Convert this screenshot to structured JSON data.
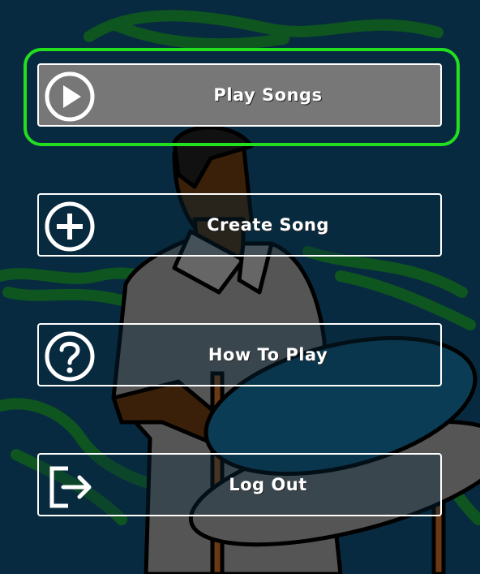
{
  "colors": {
    "background": "#082a40",
    "focus_ring": "#22e01e",
    "selected_fill": "#777777",
    "border": "#ffffff"
  },
  "menu": {
    "selected_index": 0,
    "items": [
      {
        "label": "Play Songs",
        "icon": "play-icon"
      },
      {
        "label": "Create Song",
        "icon": "plus-icon"
      },
      {
        "label": "How To Play",
        "icon": "question-icon"
      },
      {
        "label": "Log Out",
        "icon": "logout-icon"
      }
    ]
  }
}
